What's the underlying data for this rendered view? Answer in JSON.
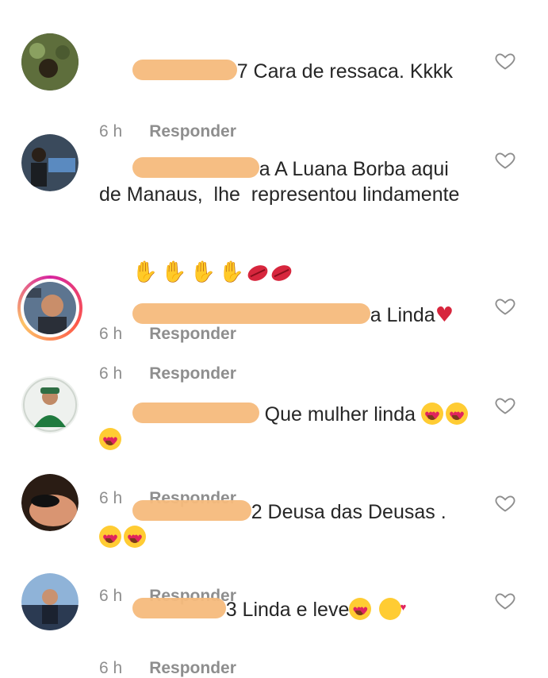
{
  "comments": [
    {
      "text": "7 Cara de ressaca. Kkkk",
      "time": "6 h",
      "reply": "Responder",
      "avatar_colors": [
        "#5a6b3a",
        "#2f3a28"
      ]
    },
    {
      "text": "a A Luana Borba aqui de Manaus,  lhe  representou lindamente",
      "time": "6 h",
      "reply": "Responder",
      "avatar_colors": [
        "#4a5d72",
        "#1e2b38"
      ]
    },
    {
      "text": "a Linda",
      "time": "6 h",
      "reply": "Responder",
      "avatar_colors": [
        "#58708a",
        "#d8a07c"
      ]
    },
    {
      "text": "Que mulher linda",
      "time": "6 h",
      "reply": "Responder",
      "avatar_colors": [
        "#1e6e3a",
        "#e8e8e8"
      ]
    },
    {
      "text": "2 Deusa das Deusas .",
      "time": "6 h",
      "reply": "Responder",
      "avatar_colors": [
        "#c8805a",
        "#3a2418"
      ]
    },
    {
      "text": "3 Linda e leve",
      "time": "6 h",
      "reply": "Responder",
      "avatar_colors": [
        "#3d6a9a",
        "#1a2a40"
      ]
    }
  ],
  "icons": {
    "like": "heart-outline-icon"
  },
  "colors": {
    "text": "#262626",
    "meta": "#8e8e8e",
    "redaction": "#f6ba7c"
  }
}
